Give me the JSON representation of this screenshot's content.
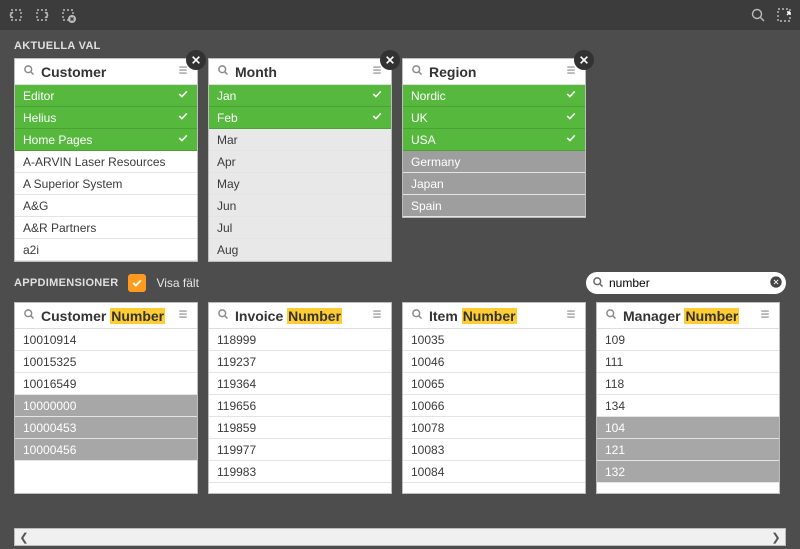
{
  "topbar": {
    "icon1": "step-back",
    "icon2": "step-fwd",
    "icon3": "clear-all",
    "search": "search",
    "selections": "selections-tool"
  },
  "section_current": "AKTUELLA VAL",
  "section_dim": "APPDIMENSIONER",
  "show_fields": {
    "label": "Visa fält",
    "checked": true
  },
  "search": {
    "value": "number"
  },
  "sel_cards": [
    {
      "title": "Customer",
      "items": [
        {
          "label": "Editor",
          "state": "selected"
        },
        {
          "label": "Helius",
          "state": "selected"
        },
        {
          "label": "Home Pages",
          "state": "selected"
        },
        {
          "label": "A-ARVIN Laser Resources",
          "state": ""
        },
        {
          "label": "A Superior System",
          "state": ""
        },
        {
          "label": "A&G",
          "state": ""
        },
        {
          "label": "A&R Partners",
          "state": ""
        },
        {
          "label": "a2i",
          "state": ""
        }
      ]
    },
    {
      "title": "Month",
      "items": [
        {
          "label": "Jan",
          "state": "selected"
        },
        {
          "label": "Feb",
          "state": "selected"
        },
        {
          "label": "Mar",
          "state": "alt"
        },
        {
          "label": "Apr",
          "state": "alt"
        },
        {
          "label": "May",
          "state": "alt"
        },
        {
          "label": "Jun",
          "state": "alt"
        },
        {
          "label": "Jul",
          "state": "alt"
        },
        {
          "label": "Aug",
          "state": "alt"
        }
      ]
    },
    {
      "title": "Region",
      "items": [
        {
          "label": "Nordic",
          "state": "selected"
        },
        {
          "label": "UK",
          "state": "selected"
        },
        {
          "label": "USA",
          "state": "selected"
        },
        {
          "label": "Germany",
          "state": "excl"
        },
        {
          "label": "Japan",
          "state": "excl"
        },
        {
          "label": "Spain",
          "state": "excl"
        }
      ]
    }
  ],
  "dim_cards": [
    {
      "title_pre": "Customer ",
      "title_hl": "Number",
      "items": [
        {
          "label": "10010914",
          "state": ""
        },
        {
          "label": "10015325",
          "state": ""
        },
        {
          "label": "10016549",
          "state": ""
        },
        {
          "label": "10000000",
          "state": "alt2"
        },
        {
          "label": "10000453",
          "state": "alt2"
        },
        {
          "label": "10000456",
          "state": "alt2"
        }
      ]
    },
    {
      "title_pre": "Invoice ",
      "title_hl": "Number",
      "items": [
        {
          "label": "118999",
          "state": ""
        },
        {
          "label": "119237",
          "state": ""
        },
        {
          "label": "119364",
          "state": ""
        },
        {
          "label": "119656",
          "state": ""
        },
        {
          "label": "119859",
          "state": ""
        },
        {
          "label": "119977",
          "state": ""
        },
        {
          "label": "119983",
          "state": ""
        }
      ]
    },
    {
      "title_pre": "Item ",
      "title_hl": "Number",
      "items": [
        {
          "label": "10035",
          "state": ""
        },
        {
          "label": "10046",
          "state": ""
        },
        {
          "label": "10065",
          "state": ""
        },
        {
          "label": "10066",
          "state": ""
        },
        {
          "label": "10078",
          "state": ""
        },
        {
          "label": "10083",
          "state": ""
        },
        {
          "label": "10084",
          "state": ""
        }
      ]
    },
    {
      "title_pre": "Manager ",
      "title_hl": "Number",
      "items": [
        {
          "label": "109",
          "state": ""
        },
        {
          "label": "111",
          "state": ""
        },
        {
          "label": "118",
          "state": ""
        },
        {
          "label": "134",
          "state": ""
        },
        {
          "label": "104",
          "state": "alt2"
        },
        {
          "label": "121",
          "state": "alt2"
        },
        {
          "label": "132",
          "state": "alt2"
        }
      ]
    }
  ]
}
